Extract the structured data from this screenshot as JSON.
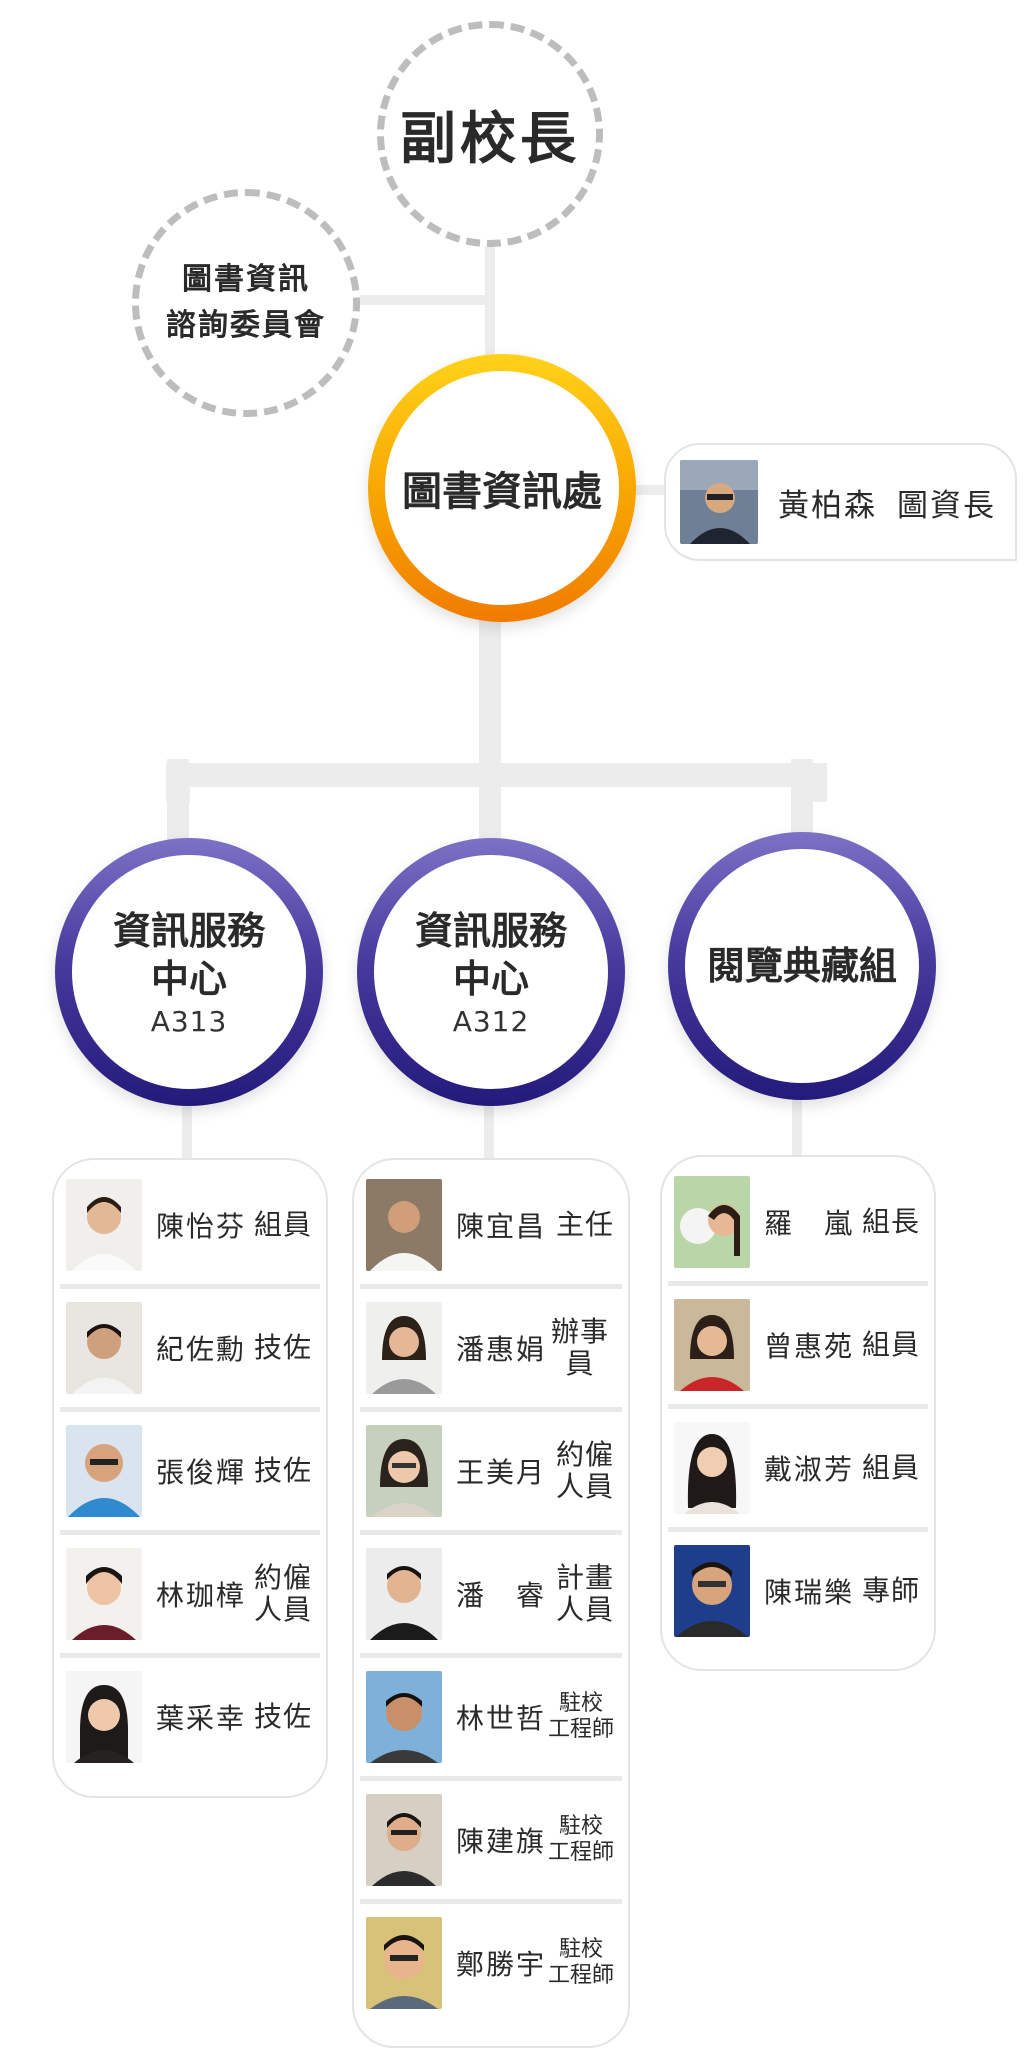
{
  "vice_president": {
    "label": "副校長"
  },
  "committee": {
    "line1": "圖書資訊",
    "line2": "諮詢委員會"
  },
  "library_office": {
    "label": "圖書資訊處",
    "director": {
      "name": "黃柏森",
      "role": "圖資長"
    }
  },
  "departments": [
    {
      "label": "資訊服務中心",
      "line1": "資訊服務",
      "line2": "中心",
      "room": "A313",
      "staff": [
        {
          "name": "陳怡芬",
          "role": "組員"
        },
        {
          "name": "紀佐勳",
          "role": "技佐"
        },
        {
          "name": "張俊輝",
          "role": "技佐"
        },
        {
          "name": "林珈樟",
          "role": "約僱人員",
          "role1": "約僱",
          "role2": "人員"
        },
        {
          "name": "葉采幸",
          "role": "技佐"
        }
      ]
    },
    {
      "label": "資訊服務中心",
      "line1": "資訊服務",
      "line2": "中心",
      "room": "A312",
      "staff": [
        {
          "name": "陳宜昌",
          "role": "主任"
        },
        {
          "name": "潘惠娟",
          "role": "辦事員"
        },
        {
          "name": "王美月",
          "role": "約僱人員",
          "role1": "約僱",
          "role2": "人員"
        },
        {
          "name": "潘　睿",
          "role": "計畫人員",
          "role1": "計畫",
          "role2": "人員"
        },
        {
          "name": "林世哲",
          "role": "駐校工程師",
          "role1": "駐校",
          "role2": "工程師"
        },
        {
          "name": "陳建旗",
          "role": "駐校工程師",
          "role1": "駐校",
          "role2": "工程師"
        },
        {
          "name": "鄭勝宇",
          "role": "駐校工程師",
          "role1": "駐校",
          "role2": "工程師"
        }
      ]
    },
    {
      "label": "閱覽典藏組",
      "staff": [
        {
          "name": "羅　嵐",
          "role": "組長"
        },
        {
          "name": "曾惠苑",
          "role": "組員"
        },
        {
          "name": "戴淑芳",
          "role": "組員"
        },
        {
          "name": "陳瑞樂",
          "role": "專師"
        }
      ]
    }
  ],
  "colors": {
    "main_ring": "#f7a400",
    "dept_ring": "#3b2f96",
    "dashed": "#bdbdbd",
    "connector": "#ececec"
  }
}
